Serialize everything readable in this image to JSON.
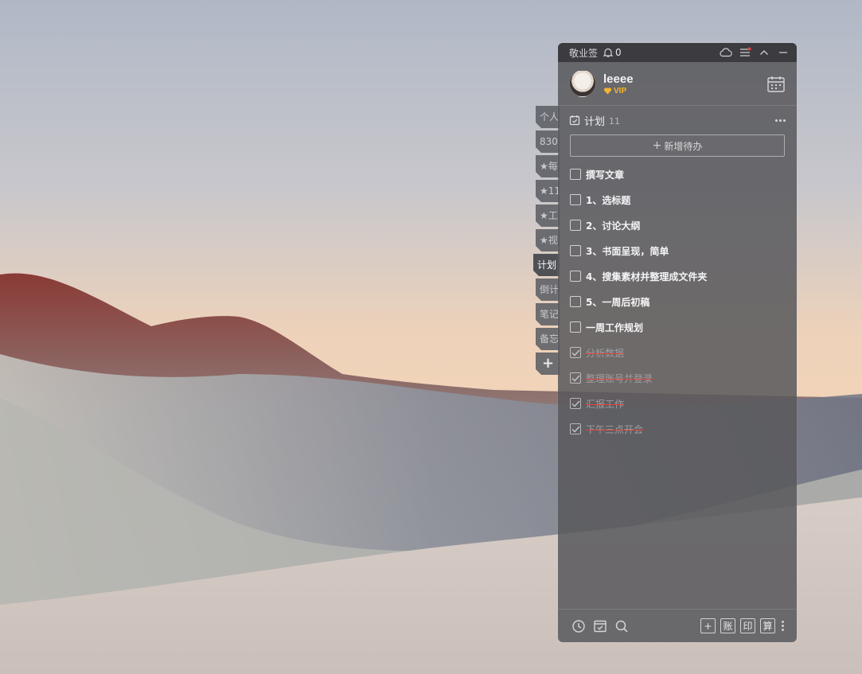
{
  "app": {
    "title": "敬业签",
    "notification_count": "0"
  },
  "user": {
    "name": "leeee",
    "vip_label": "VIP"
  },
  "side_tabs": [
    {
      "label": "个人",
      "active": false
    },
    {
      "label": "830",
      "active": false
    },
    {
      "label": "★每",
      "active": false
    },
    {
      "label": "★11",
      "active": false
    },
    {
      "label": "★工",
      "active": false
    },
    {
      "label": "★视",
      "active": false
    },
    {
      "label": "计划",
      "active": true
    },
    {
      "label": "倒计",
      "active": false
    },
    {
      "label": "笔记",
      "active": false
    },
    {
      "label": "备忘",
      "active": false
    }
  ],
  "add_tab_label": "+",
  "list": {
    "title": "计划",
    "count": "11",
    "add_button_label": "新增待办",
    "add_button_plus": "+"
  },
  "todos": [
    {
      "text": "撰写文章",
      "done": false
    },
    {
      "text": "1、选标题",
      "done": false
    },
    {
      "text": "2、讨论大纲",
      "done": false
    },
    {
      "text": "3、书面呈现，简单",
      "done": false
    },
    {
      "text": "4、搜集素材并整理成文件夹",
      "done": false
    },
    {
      "text": "5、一周后初稿",
      "done": false
    },
    {
      "text": "一周工作规划",
      "done": false
    },
    {
      "text": "分析数据",
      "done": true
    },
    {
      "text": "整理账号并登录",
      "done": true
    },
    {
      "text": "汇报工作",
      "done": true
    },
    {
      "text": "下午三点开会",
      "done": true
    }
  ],
  "bottom_tools": {
    "add": "+",
    "ledger": "账",
    "stamp": "印",
    "calculator": "算"
  },
  "colors": {
    "vip": "#f5b430",
    "strike": "#e3443f",
    "notify_dot": "#e3443f"
  },
  "icons": [
    "bell-icon",
    "cloud-icon",
    "menu-icon",
    "collapse-icon",
    "minimize-icon",
    "calendar-icon",
    "checklist-icon",
    "more-icon",
    "checkbox-icon",
    "clock-icon",
    "archive-icon",
    "search-icon"
  ]
}
